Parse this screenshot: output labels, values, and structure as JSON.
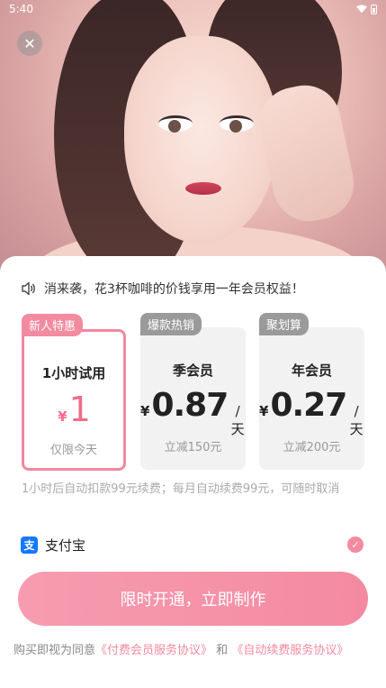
{
  "status_bar": {
    "time": "5:40"
  },
  "notice": {
    "text": "消来袭，花3杯咖啡的价钱享用一年会员权益！"
  },
  "plans": [
    {
      "tag": "新人特惠",
      "title": "1小时试用",
      "currency": "¥",
      "price": "1",
      "unit": "",
      "subtitle": "仅限今天",
      "selected": true
    },
    {
      "tag": "爆款热销",
      "title": "季会员",
      "currency": "¥",
      "price": "0.87",
      "unit": "/天",
      "subtitle": "立减150元",
      "selected": false
    },
    {
      "tag": "聚划算",
      "title": "年会员",
      "currency": "¥",
      "price": "0.27",
      "unit": "/天",
      "subtitle": "立减200元",
      "selected": false
    }
  ],
  "renew_note": "1小时后自动扣款99元续费；每月自动续费99元，可随时取消",
  "payment": {
    "method": "支付宝",
    "logo_char": "支",
    "selected": true
  },
  "cta": {
    "label": "限时开通，立即制作"
  },
  "agreement": {
    "prefix": "购买即视为同意",
    "link1": "《付费会员服务协议》",
    "and": "和",
    "link2": "《自动续费服务协议》"
  },
  "colors": {
    "accent": "#f28aa0",
    "alipay": "#1677ff"
  },
  "icons": [
    "close-icon",
    "speaker-icon",
    "alipay-logo",
    "check-icon",
    "wifi-icon",
    "battery-icon"
  ]
}
